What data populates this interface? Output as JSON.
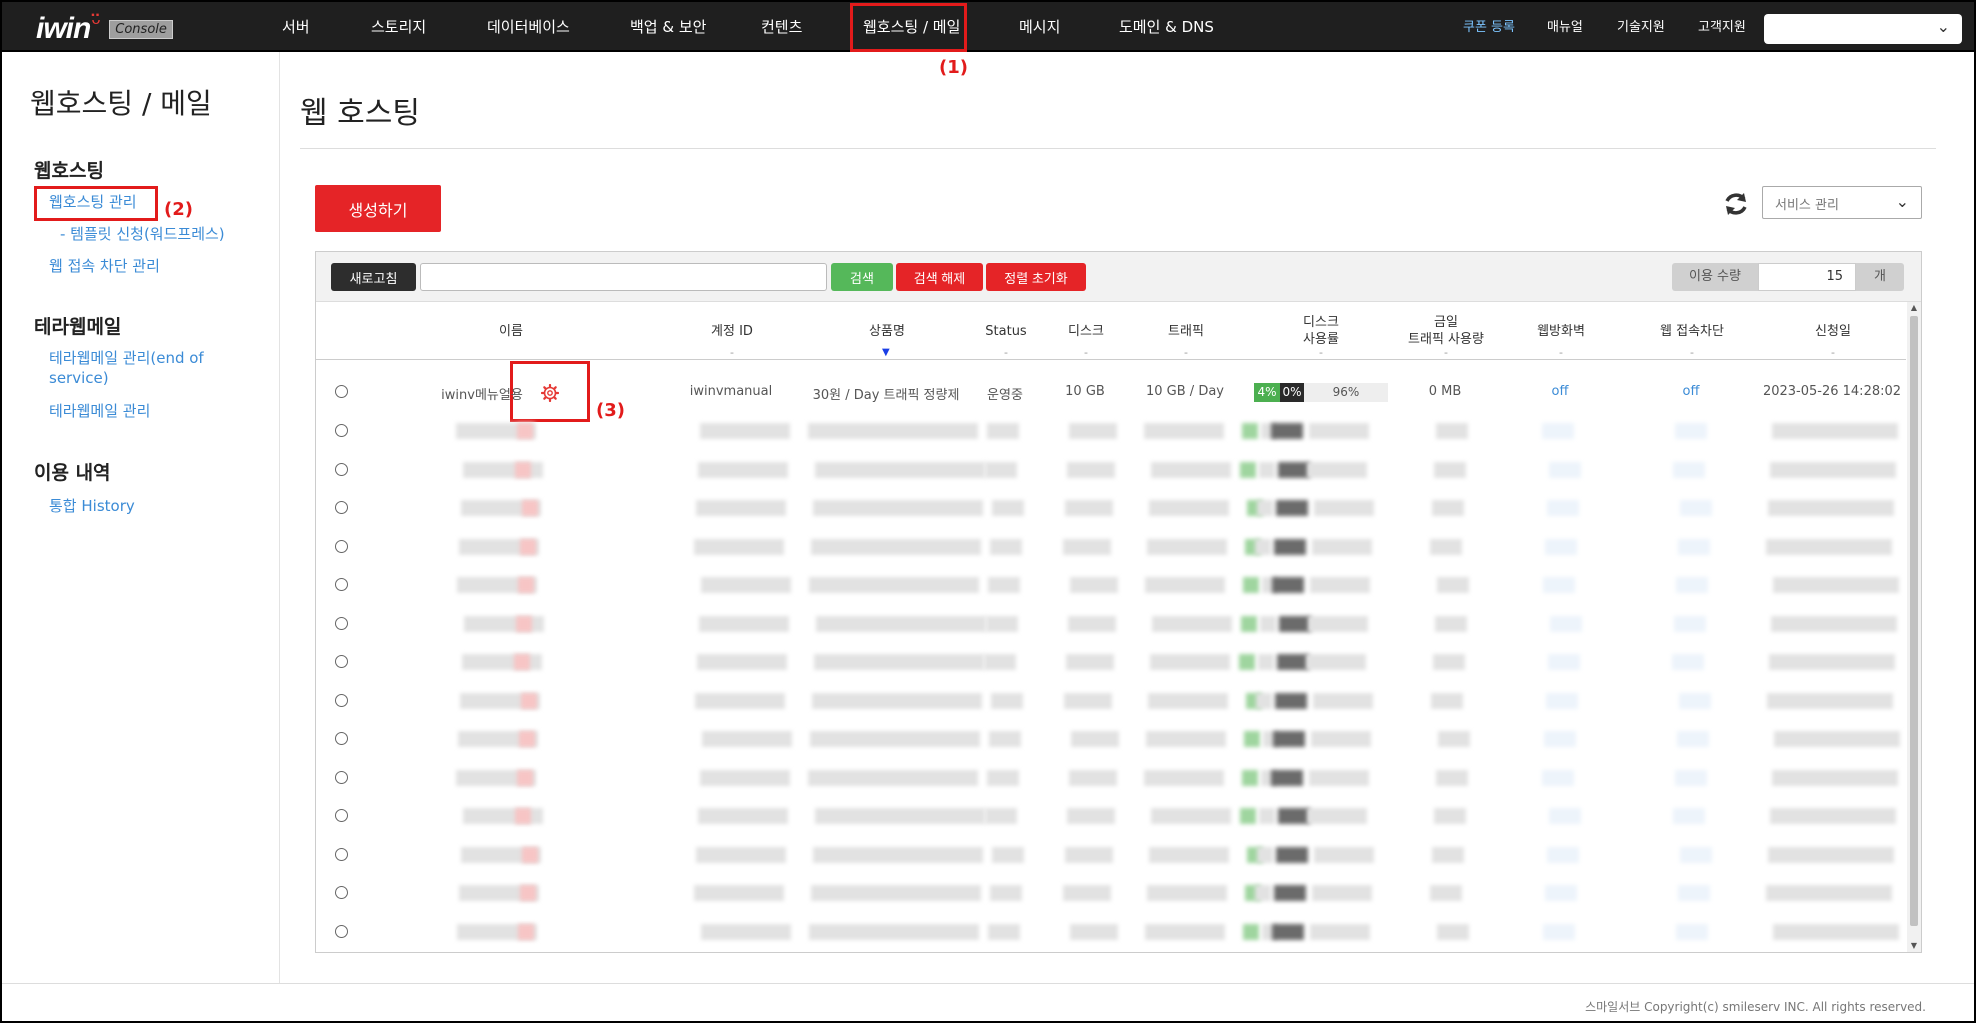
{
  "logo": {
    "text": "iwin",
    "console": "Console"
  },
  "nav": {
    "items": [
      "서버",
      "스토리지",
      "데이터베이스",
      "백업 & 보안",
      "컨텐츠",
      "웹호스팅 / 메일",
      "메시지",
      "도메인 & DNS"
    ],
    "right": [
      "쿠폰 등록",
      "매뉴얼",
      "기술지원",
      "고객지원"
    ],
    "account_select": ""
  },
  "annotations": [
    "(1)",
    "(2)",
    "(3)"
  ],
  "sidebar": {
    "title": "웹호스팅 / 메일",
    "groups": [
      {
        "title": "웹호스팅",
        "links": [
          "웹호스팅 관리",
          "- 템플릿 신청(워드프레스)",
          "웹 접속 차단 관리"
        ]
      },
      {
        "title": "테라웹메일",
        "links": [
          "테라웹메일 관리(end of service)",
          "테라웹메일 관리"
        ]
      },
      {
        "title": "이용 내역",
        "links": [
          "통합 History"
        ]
      }
    ]
  },
  "main": {
    "title": "웹 호스팅",
    "create_label": "생성하기",
    "service_select": "서비스 관리"
  },
  "toolbar": {
    "refresh_label": "새로고침",
    "search_value": "",
    "search_label": "검색",
    "clear_label": "검색 해제",
    "sort_reset_label": "정렬 초기화",
    "qty_label": "이용 수량",
    "qty_value": "15",
    "qty_unit": "개"
  },
  "table": {
    "headers": [
      "이름",
      "계정 ID",
      "상품명",
      "Status",
      "디스크",
      "트래픽",
      "디스크\n사용률",
      "금일\n트래픽 사용량",
      "웹방화벽",
      "웹 접속차단",
      "신청일"
    ],
    "filter_placeholder": "-",
    "first_row": {
      "name": "iwinv메뉴얼용",
      "account_id": "iwinvmanual",
      "product": "30원 / Day 트래픽 정량제",
      "status": "운영중",
      "disk": "10 GB",
      "traffic": "10 GB / Day",
      "disk_usage": {
        "used": "4%",
        "other": "0%",
        "free": "96%"
      },
      "today_traffic": "0 MB",
      "waf": "off",
      "web_block": "off",
      "date": "2023-05-26 14:28:02"
    },
    "blurred_rows": 14
  },
  "footer": "스마일서브 Copyright(c) smileserv INC. All rights reserved."
}
